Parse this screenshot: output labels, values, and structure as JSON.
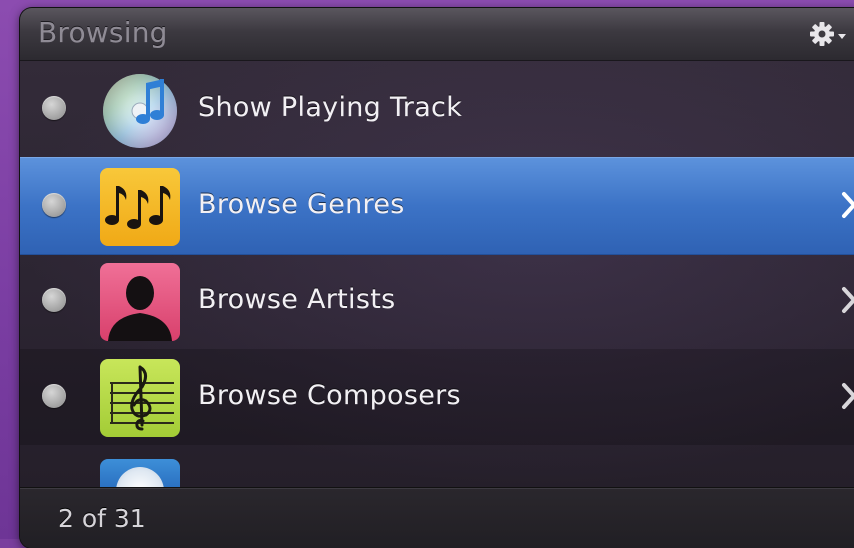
{
  "window": {
    "title": "Browsing",
    "gear_icon": "gear-icon"
  },
  "rows": [
    {
      "label": "Show Playing Track",
      "icon": "itunes-icon",
      "selected": false,
      "has_chevron": false
    },
    {
      "label": "Browse Genres",
      "icon": "music-notes-icon",
      "selected": true,
      "has_chevron": true
    },
    {
      "label": "Browse Artists",
      "icon": "artist-silhouette-icon",
      "selected": false,
      "has_chevron": true
    },
    {
      "label": "Browse Composers",
      "icon": "treble-clef-icon",
      "selected": false,
      "has_chevron": true
    }
  ],
  "footer": {
    "count": "2 of 31"
  },
  "colors": {
    "selection": "#3c73c6",
    "genres_tile": "#f2b322",
    "artists_tile": "#e44f7a",
    "composers_tile": "#b5d94a"
  }
}
